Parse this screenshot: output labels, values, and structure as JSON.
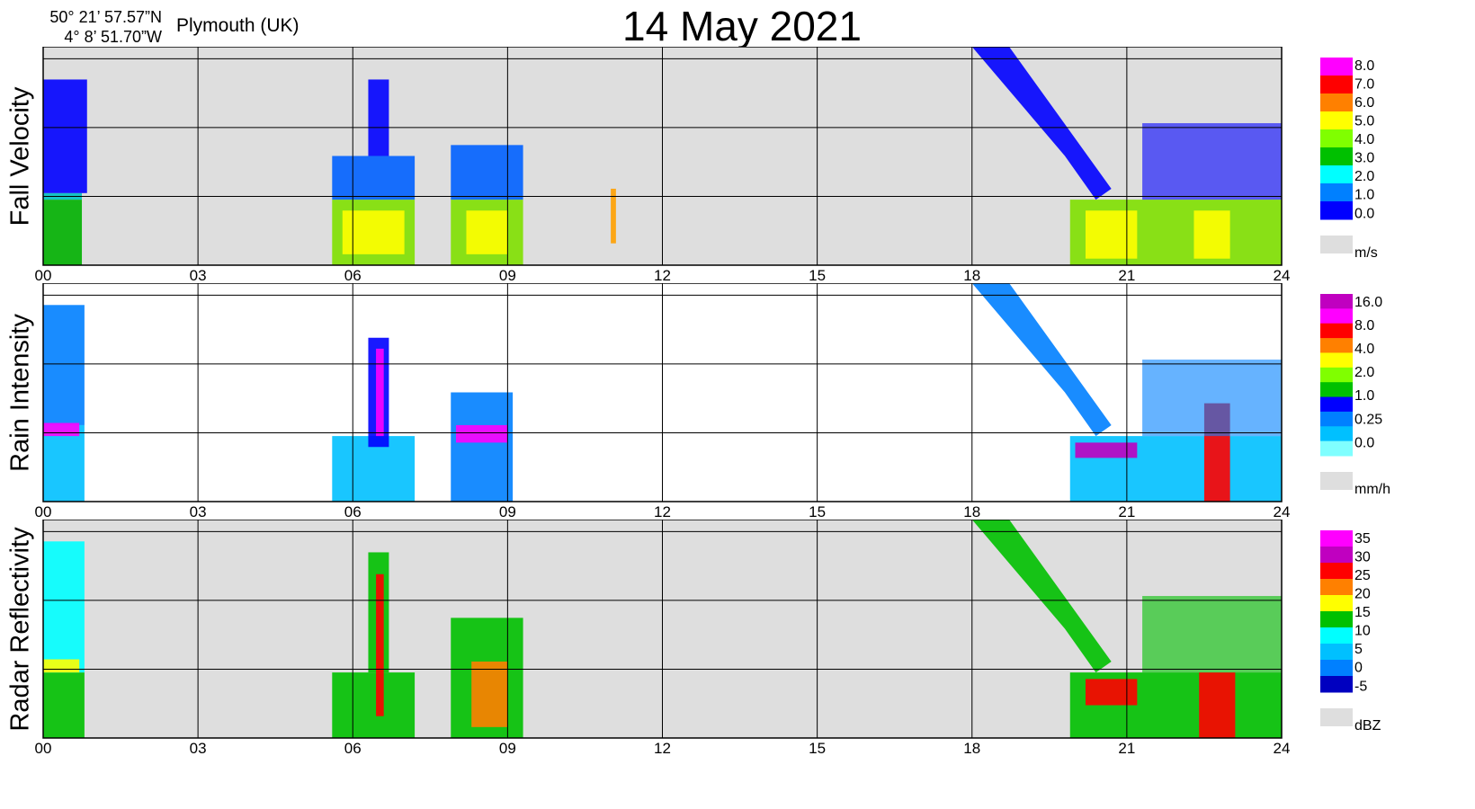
{
  "header": {
    "latitude": "50° 21’ 57.57”N",
    "longitude": "4° 8’ 51.70”W",
    "location": "Plymouth (UK)",
    "date": "14 May 2021"
  },
  "colors": {
    "no_data": "#dedede",
    "grid": "#000000"
  },
  "chart_data": [
    {
      "type": "heatmap",
      "ylabel": "Fall Velocity",
      "x_tick_labels": [
        "00",
        "03",
        "06",
        "09",
        "12",
        "15",
        "18",
        "21",
        "24"
      ],
      "xlim": [
        0,
        24
      ],
      "background": "#dedede",
      "colorbar": {
        "unit": "m/s",
        "labels": [
          "8.0",
          "7.0",
          "6.0",
          "5.0",
          "4.0",
          "3.0",
          "2.0",
          "1.0",
          "0.0"
        ],
        "colors": [
          "#ff00ff",
          "#ff0000",
          "#ff8000",
          "#ffff00",
          "#80ff00",
          "#00c000",
          "#00ffff",
          "#0080ff",
          "#0000ff"
        ]
      },
      "regions": [
        {
          "x": [
            0.0,
            0.75
          ],
          "y": [
            0.0,
            0.3
          ],
          "color": "#00b000"
        },
        {
          "x": [
            0.0,
            0.75
          ],
          "y": [
            0.3,
            0.33
          ],
          "color": "#00c0c0"
        },
        {
          "x": [
            0.0,
            0.85
          ],
          "y": [
            0.33,
            0.85
          ],
          "color": "#0000ff"
        },
        {
          "x": [
            5.6,
            7.2
          ],
          "y": [
            0.0,
            0.3
          ],
          "color": "#80e000"
        },
        {
          "x": [
            5.8,
            7.0
          ],
          "y": [
            0.05,
            0.25
          ],
          "color": "#ffff00"
        },
        {
          "x": [
            5.6,
            7.2
          ],
          "y": [
            0.3,
            0.5
          ],
          "color": "#0060ff"
        },
        {
          "x": [
            6.3,
            6.7
          ],
          "y": [
            0.5,
            0.85
          ],
          "color": "#0000ff"
        },
        {
          "x": [
            7.9,
            9.3
          ],
          "y": [
            0.0,
            0.3
          ],
          "color": "#80e000"
        },
        {
          "x": [
            8.2,
            9.0
          ],
          "y": [
            0.05,
            0.25
          ],
          "color": "#ffff00"
        },
        {
          "x": [
            7.9,
            9.3
          ],
          "y": [
            0.3,
            0.55
          ],
          "color": "#0060ff"
        },
        {
          "x": [
            11.0,
            11.1
          ],
          "y": [
            0.1,
            0.35
          ],
          "color": "#ffa000"
        },
        {
          "x": [
            19.9,
            24.0
          ],
          "y": [
            0.0,
            0.3
          ],
          "color": "#80e000"
        },
        {
          "x": [
            20.2,
            21.2
          ],
          "y": [
            0.03,
            0.25
          ],
          "color": "#ffff00"
        },
        {
          "x": [
            22.3,
            23.0
          ],
          "y": [
            0.03,
            0.25
          ],
          "color": "#ffff00"
        },
        {
          "x": [
            18.0,
            24.0
          ],
          "y": [
            0.3,
            1.0
          ],
          "color": "#0000ff",
          "slant": true
        }
      ]
    },
    {
      "type": "heatmap",
      "ylabel": "Rain Intensity",
      "x_tick_labels": [
        "00",
        "03",
        "06",
        "09",
        "12",
        "15",
        "18",
        "21",
        "24"
      ],
      "xlim": [
        0,
        24
      ],
      "background": "#ffffff",
      "colorbar": {
        "unit": "mm/h",
        "labels": [
          "16.0",
          "8.0",
          "4.0",
          "2.0",
          "1.0",
          "0.25",
          "0.0"
        ],
        "colors": [
          "#c000c0",
          "#ff00ff",
          "#ff0000",
          "#ff8000",
          "#ffff00",
          "#80ff00",
          "#00c000",
          "#0000ff",
          "#0080ff",
          "#00c0ff",
          "#80ffff"
        ]
      },
      "regions": [
        {
          "x": [
            0.0,
            0.8
          ],
          "y": [
            0.0,
            0.35
          ],
          "color": "#00c0ff"
        },
        {
          "x": [
            0.0,
            0.8
          ],
          "y": [
            0.35,
            0.9
          ],
          "color": "#0080ff"
        },
        {
          "x": [
            0.0,
            0.7
          ],
          "y": [
            0.3,
            0.36
          ],
          "color": "#ff00ff"
        },
        {
          "x": [
            5.6,
            7.2
          ],
          "y": [
            0.0,
            0.3
          ],
          "color": "#00c0ff"
        },
        {
          "x": [
            6.3,
            6.7
          ],
          "y": [
            0.25,
            0.75
          ],
          "color": "#0000ff"
        },
        {
          "x": [
            6.45,
            6.6
          ],
          "y": [
            0.3,
            0.7
          ],
          "color": "#ff00ff"
        },
        {
          "x": [
            7.9,
            9.1
          ],
          "y": [
            0.0,
            0.5
          ],
          "color": "#0080ff"
        },
        {
          "x": [
            8.0,
            9.0
          ],
          "y": [
            0.27,
            0.35
          ],
          "color": "#ff00ff"
        },
        {
          "x": [
            19.9,
            24.0
          ],
          "y": [
            0.0,
            0.3
          ],
          "color": "#00c0ff"
        },
        {
          "x": [
            20.0,
            21.2
          ],
          "y": [
            0.2,
            0.27
          ],
          "color": "#c000c0"
        },
        {
          "x": [
            22.5,
            23.0
          ],
          "y": [
            0.0,
            0.45
          ],
          "color": "#ff0000"
        },
        {
          "x": [
            18.0,
            24.0
          ],
          "y": [
            0.3,
            1.0
          ],
          "color": "#0080ff",
          "slant": true
        }
      ]
    },
    {
      "type": "heatmap",
      "ylabel": "Radar Reflectivity",
      "x_tick_labels": [
        "00",
        "03",
        "06",
        "09",
        "12",
        "15",
        "18",
        "21",
        "24"
      ],
      "xlim": [
        0,
        24
      ],
      "background": "#dedede",
      "colorbar": {
        "unit": "dBZ",
        "labels": [
          "35",
          "30",
          "25",
          "20",
          "15",
          "10",
          "5",
          "0",
          "-5"
        ],
        "colors": [
          "#ff00ff",
          "#c000c0",
          "#ff0000",
          "#ff8000",
          "#ffff00",
          "#00c000",
          "#00ffff",
          "#00c0ff",
          "#0080ff",
          "#0000c0"
        ]
      },
      "regions": [
        {
          "x": [
            0.0,
            0.8
          ],
          "y": [
            0.0,
            0.3
          ],
          "color": "#00c000"
        },
        {
          "x": [
            0.0,
            0.8
          ],
          "y": [
            0.3,
            0.9
          ],
          "color": "#00ffff"
        },
        {
          "x": [
            0.0,
            0.7
          ],
          "y": [
            0.3,
            0.36
          ],
          "color": "#ffff00"
        },
        {
          "x": [
            5.6,
            7.2
          ],
          "y": [
            0.0,
            0.3
          ],
          "color": "#00c000"
        },
        {
          "x": [
            6.3,
            6.7
          ],
          "y": [
            0.3,
            0.85
          ],
          "color": "#00c000"
        },
        {
          "x": [
            6.45,
            6.6
          ],
          "y": [
            0.1,
            0.75
          ],
          "color": "#ff0000"
        },
        {
          "x": [
            7.9,
            9.3
          ],
          "y": [
            0.0,
            0.55
          ],
          "color": "#00c000"
        },
        {
          "x": [
            8.3,
            9.0
          ],
          "y": [
            0.05,
            0.35
          ],
          "color": "#ff8000"
        },
        {
          "x": [
            19.9,
            24.0
          ],
          "y": [
            0.0,
            0.3
          ],
          "color": "#00c000"
        },
        {
          "x": [
            20.2,
            21.2
          ],
          "y": [
            0.15,
            0.27
          ],
          "color": "#ff0000"
        },
        {
          "x": [
            22.4,
            23.1
          ],
          "y": [
            0.0,
            0.3
          ],
          "color": "#ff0000"
        },
        {
          "x": [
            18.0,
            24.0
          ],
          "y": [
            0.3,
            1.0
          ],
          "color": "#00c000",
          "slant": true
        }
      ]
    }
  ]
}
